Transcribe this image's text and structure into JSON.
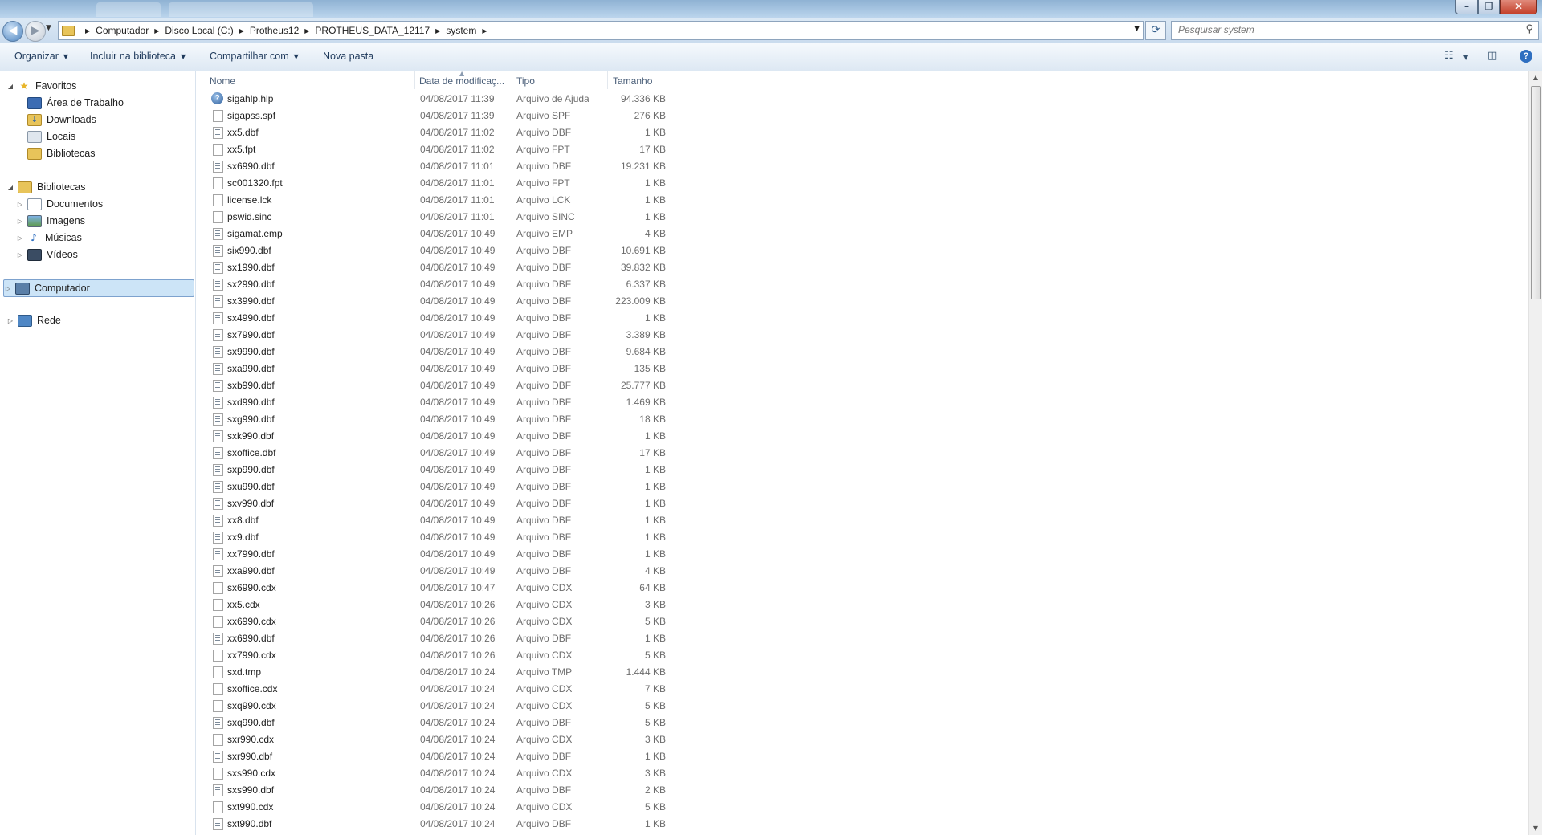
{
  "window": {
    "minimize_glyph": "–",
    "maximize_glyph": "❐",
    "close_glyph": "✕"
  },
  "address": {
    "back_glyph": "◀",
    "forward_glyph": "▶",
    "breadcrumbs": [
      "Computador",
      "Disco Local (C:)",
      "Protheus12",
      "PROTHEUS_DATA_12117",
      "system"
    ],
    "refresh_glyph": "⟳",
    "search_placeholder": "Pesquisar system",
    "search_icon": "search-icon"
  },
  "toolbar": {
    "organize": "Organizar",
    "include_library": "Incluir na biblioteca",
    "share_with": "Compartilhar com",
    "new_folder": "Nova pasta",
    "help": "?"
  },
  "nav": {
    "favorites": "Favoritos",
    "desktop": "Área de Trabalho",
    "downloads": "Downloads",
    "places": "Locais",
    "libraries_fav": "Bibliotecas",
    "libraries": "Bibliotecas",
    "documents": "Documentos",
    "images": "Imagens",
    "music": "Músicas",
    "videos": "Vídeos",
    "computer": "Computador",
    "network": "Rede"
  },
  "columns": {
    "name": "Nome",
    "date": "Data de modificaç...",
    "type": "Tipo",
    "size": "Tamanho"
  },
  "files": [
    {
      "name": "sigahlp.hlp",
      "date": "04/08/2017 11:39",
      "type": "Arquivo de Ajuda",
      "size": "94.336 KB",
      "icon": "help"
    },
    {
      "name": "sigapss.spf",
      "date": "04/08/2017 11:39",
      "type": "Arquivo SPF",
      "size": "276 KB",
      "icon": "blank"
    },
    {
      "name": "xx5.dbf",
      "date": "04/08/2017 11:02",
      "type": "Arquivo DBF",
      "size": "1 KB",
      "icon": "dbf"
    },
    {
      "name": "xx5.fpt",
      "date": "04/08/2017 11:02",
      "type": "Arquivo FPT",
      "size": "17 KB",
      "icon": "blank"
    },
    {
      "name": "sx6990.dbf",
      "date": "04/08/2017 11:01",
      "type": "Arquivo DBF",
      "size": "19.231 KB",
      "icon": "dbf"
    },
    {
      "name": "sc001320.fpt",
      "date": "04/08/2017 11:01",
      "type": "Arquivo FPT",
      "size": "1 KB",
      "icon": "blank"
    },
    {
      "name": "license.lck",
      "date": "04/08/2017 11:01",
      "type": "Arquivo LCK",
      "size": "1 KB",
      "icon": "blank"
    },
    {
      "name": "pswid.sinc",
      "date": "04/08/2017 11:01",
      "type": "Arquivo SINC",
      "size": "1 KB",
      "icon": "blank"
    },
    {
      "name": "sigamat.emp",
      "date": "04/08/2017 10:49",
      "type": "Arquivo EMP",
      "size": "4 KB",
      "icon": "dbf"
    },
    {
      "name": "six990.dbf",
      "date": "04/08/2017 10:49",
      "type": "Arquivo DBF",
      "size": "10.691 KB",
      "icon": "dbf"
    },
    {
      "name": "sx1990.dbf",
      "date": "04/08/2017 10:49",
      "type": "Arquivo DBF",
      "size": "39.832 KB",
      "icon": "dbf"
    },
    {
      "name": "sx2990.dbf",
      "date": "04/08/2017 10:49",
      "type": "Arquivo DBF",
      "size": "6.337 KB",
      "icon": "dbf"
    },
    {
      "name": "sx3990.dbf",
      "date": "04/08/2017 10:49",
      "type": "Arquivo DBF",
      "size": "223.009 KB",
      "icon": "dbf"
    },
    {
      "name": "sx4990.dbf",
      "date": "04/08/2017 10:49",
      "type": "Arquivo DBF",
      "size": "1 KB",
      "icon": "dbf"
    },
    {
      "name": "sx7990.dbf",
      "date": "04/08/2017 10:49",
      "type": "Arquivo DBF",
      "size": "3.389 KB",
      "icon": "dbf"
    },
    {
      "name": "sx9990.dbf",
      "date": "04/08/2017 10:49",
      "type": "Arquivo DBF",
      "size": "9.684 KB",
      "icon": "dbf"
    },
    {
      "name": "sxa990.dbf",
      "date": "04/08/2017 10:49",
      "type": "Arquivo DBF",
      "size": "135 KB",
      "icon": "dbf"
    },
    {
      "name": "sxb990.dbf",
      "date": "04/08/2017 10:49",
      "type": "Arquivo DBF",
      "size": "25.777 KB",
      "icon": "dbf"
    },
    {
      "name": "sxd990.dbf",
      "date": "04/08/2017 10:49",
      "type": "Arquivo DBF",
      "size": "1.469 KB",
      "icon": "dbf"
    },
    {
      "name": "sxg990.dbf",
      "date": "04/08/2017 10:49",
      "type": "Arquivo DBF",
      "size": "18 KB",
      "icon": "dbf"
    },
    {
      "name": "sxk990.dbf",
      "date": "04/08/2017 10:49",
      "type": "Arquivo DBF",
      "size": "1 KB",
      "icon": "dbf"
    },
    {
      "name": "sxoffice.dbf",
      "date": "04/08/2017 10:49",
      "type": "Arquivo DBF",
      "size": "17 KB",
      "icon": "dbf"
    },
    {
      "name": "sxp990.dbf",
      "date": "04/08/2017 10:49",
      "type": "Arquivo DBF",
      "size": "1 KB",
      "icon": "dbf"
    },
    {
      "name": "sxu990.dbf",
      "date": "04/08/2017 10:49",
      "type": "Arquivo DBF",
      "size": "1 KB",
      "icon": "dbf"
    },
    {
      "name": "sxv990.dbf",
      "date": "04/08/2017 10:49",
      "type": "Arquivo DBF",
      "size": "1 KB",
      "icon": "dbf"
    },
    {
      "name": "xx8.dbf",
      "date": "04/08/2017 10:49",
      "type": "Arquivo DBF",
      "size": "1 KB",
      "icon": "dbf"
    },
    {
      "name": "xx9.dbf",
      "date": "04/08/2017 10:49",
      "type": "Arquivo DBF",
      "size": "1 KB",
      "icon": "dbf"
    },
    {
      "name": "xx7990.dbf",
      "date": "04/08/2017 10:49",
      "type": "Arquivo DBF",
      "size": "1 KB",
      "icon": "dbf"
    },
    {
      "name": "xxa990.dbf",
      "date": "04/08/2017 10:49",
      "type": "Arquivo DBF",
      "size": "4 KB",
      "icon": "dbf"
    },
    {
      "name": "sx6990.cdx",
      "date": "04/08/2017 10:47",
      "type": "Arquivo CDX",
      "size": "64 KB",
      "icon": "blank"
    },
    {
      "name": "xx5.cdx",
      "date": "04/08/2017 10:26",
      "type": "Arquivo CDX",
      "size": "3 KB",
      "icon": "blank"
    },
    {
      "name": "xx6990.cdx",
      "date": "04/08/2017 10:26",
      "type": "Arquivo CDX",
      "size": "5 KB",
      "icon": "blank"
    },
    {
      "name": "xx6990.dbf",
      "date": "04/08/2017 10:26",
      "type": "Arquivo DBF",
      "size": "1 KB",
      "icon": "dbf"
    },
    {
      "name": "xx7990.cdx",
      "date": "04/08/2017 10:26",
      "type": "Arquivo CDX",
      "size": "5 KB",
      "icon": "blank"
    },
    {
      "name": "sxd.tmp",
      "date": "04/08/2017 10:24",
      "type": "Arquivo TMP",
      "size": "1.444 KB",
      "icon": "blank"
    },
    {
      "name": "sxoffice.cdx",
      "date": "04/08/2017 10:24",
      "type": "Arquivo CDX",
      "size": "7 KB",
      "icon": "blank"
    },
    {
      "name": "sxq990.cdx",
      "date": "04/08/2017 10:24",
      "type": "Arquivo CDX",
      "size": "5 KB",
      "icon": "blank"
    },
    {
      "name": "sxq990.dbf",
      "date": "04/08/2017 10:24",
      "type": "Arquivo DBF",
      "size": "5 KB",
      "icon": "dbf"
    },
    {
      "name": "sxr990.cdx",
      "date": "04/08/2017 10:24",
      "type": "Arquivo CDX",
      "size": "3 KB",
      "icon": "blank"
    },
    {
      "name": "sxr990.dbf",
      "date": "04/08/2017 10:24",
      "type": "Arquivo DBF",
      "size": "1 KB",
      "icon": "dbf"
    },
    {
      "name": "sxs990.cdx",
      "date": "04/08/2017 10:24",
      "type": "Arquivo CDX",
      "size": "3 KB",
      "icon": "blank"
    },
    {
      "name": "sxs990.dbf",
      "date": "04/08/2017 10:24",
      "type": "Arquivo DBF",
      "size": "2 KB",
      "icon": "dbf"
    },
    {
      "name": "sxt990.cdx",
      "date": "04/08/2017 10:24",
      "type": "Arquivo CDX",
      "size": "5 KB",
      "icon": "blank"
    },
    {
      "name": "sxt990.dbf",
      "date": "04/08/2017 10:24",
      "type": "Arquivo DBF",
      "size": "1 KB",
      "icon": "dbf"
    }
  ]
}
